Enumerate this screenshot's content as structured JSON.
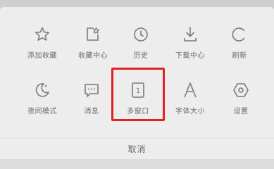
{
  "menu": {
    "row1": [
      {
        "label": "添加收藏",
        "icon": "star-icon"
      },
      {
        "label": "收藏中心",
        "icon": "bookmark-center-icon"
      },
      {
        "label": "历史",
        "icon": "clock-icon"
      },
      {
        "label": "下载中心",
        "icon": "download-icon"
      },
      {
        "label": "刷新",
        "icon": "refresh-icon"
      }
    ],
    "row2": [
      {
        "label": "夜间模式",
        "icon": "moon-icon"
      },
      {
        "label": "消息",
        "icon": "message-icon"
      },
      {
        "label": "多窗口",
        "icon": "multi-window-icon",
        "badge": "1"
      },
      {
        "label": "字体大小",
        "icon": "font-size-icon"
      },
      {
        "label": "设置",
        "icon": "settings-icon"
      }
    ],
    "cancel_label": "取消"
  },
  "colors": {
    "panel_bg": "#ededed",
    "icon_stroke": "#7a7a7a",
    "highlight": "#e02121"
  }
}
